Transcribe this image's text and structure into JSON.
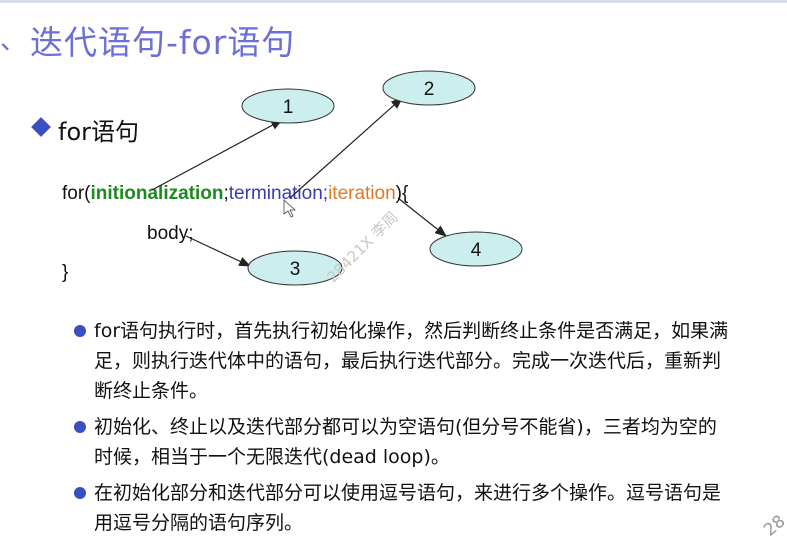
{
  "slide": {
    "title_bullet": "、",
    "title": "迭代语句-for语句",
    "subheading": "for语句",
    "code": {
      "for_open": "for(",
      "init": "initionalization",
      "sep1": ";",
      "term": "termination",
      "sep2": ";",
      "iter": "iteration",
      "close": "){",
      "body": "body;",
      "end": "}"
    },
    "ellipses": [
      "1",
      "2",
      "3",
      "4"
    ],
    "bullets": [
      "for语句执行时，首先执行初始化操作，然后判断终止条件是否满足，如果满足，则执行迭代体中的语句，最后执行迭代部分。完成一次迭代后，重新判断终止条件。",
      "初始化、终止以及迭代部分都可以为空语句(但分号不能省)，三者均为空的时候，相当于一个无限迭代(dead loop)。",
      "在初始化部分和迭代部分可以使用逗号语句，来进行多个操作。逗号语句是用逗号分隔的语句序列。"
    ],
    "watermark": "28421X 李周",
    "page_number": "28"
  },
  "colors": {
    "title": "#6b6fd6",
    "init": "#1f8a1f",
    "term": "#3a3ab0",
    "iter": "#e0782a",
    "ellipse_fill": "#cceeee",
    "bullet": "#3a4fc1"
  }
}
